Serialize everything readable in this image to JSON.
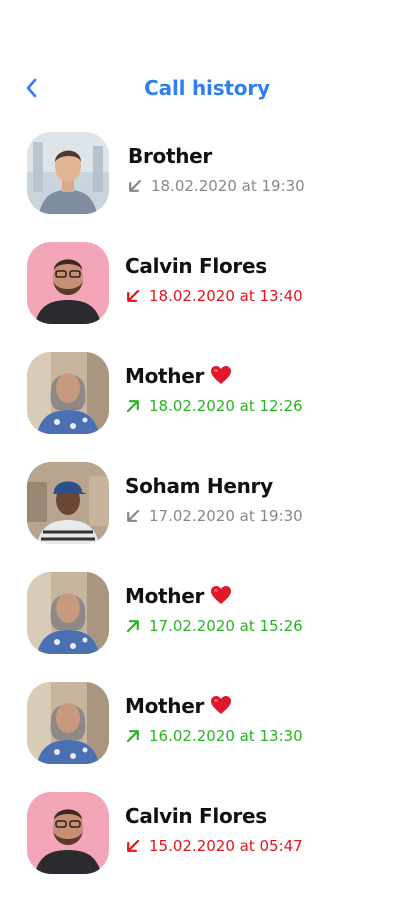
{
  "header": {
    "title": "Call history",
    "back_icon": "chevron-left-icon"
  },
  "colors": {
    "accent": "#2f80ed",
    "missed": "#e5141b",
    "outgoing": "#27b41f",
    "incoming": "#888888"
  },
  "calls": [
    {
      "name": "Brother",
      "heart": false,
      "datetime": "18.02.2020 at 19:30",
      "type": "incoming",
      "avatar": "young-man-avatar"
    },
    {
      "name": "Calvin Flores",
      "heart": false,
      "datetime": "18.02.2020 at 13:40",
      "type": "missed",
      "avatar": "bearded-man-avatar"
    },
    {
      "name": "Mother",
      "heart": true,
      "datetime": "18.02.2020 at 12:26",
      "type": "outgoing",
      "avatar": "older-woman-avatar"
    },
    {
      "name": "Soham Henry",
      "heart": false,
      "datetime": "17.02.2020 at 19:30",
      "type": "incoming",
      "avatar": "woman-cap-avatar"
    },
    {
      "name": "Mother",
      "heart": true,
      "datetime": "17.02.2020 at 15:26",
      "type": "outgoing",
      "avatar": "older-woman-avatar"
    },
    {
      "name": "Mother",
      "heart": true,
      "datetime": "16.02.2020 at 13:30",
      "type": "outgoing",
      "avatar": "older-woman-avatar"
    },
    {
      "name": "Calvin Flores",
      "heart": false,
      "datetime": "15.02.2020 at 05:47",
      "type": "missed",
      "avatar": "bearded-man-avatar"
    }
  ]
}
